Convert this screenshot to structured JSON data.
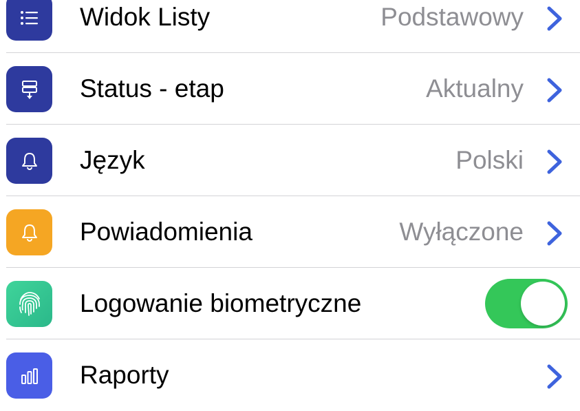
{
  "settings": {
    "colors": {
      "accent": "#3e63dd",
      "icon_navy": "#2e3a9e",
      "icon_orange": "#f5a623",
      "icon_green": "#34c793",
      "icon_blue": "#4a5ee6",
      "toggle_on": "#34c759",
      "secondary_text": "#8e8e93"
    },
    "rows": [
      {
        "label": "Widok Listy",
        "value": "Podstawowy",
        "icon": "list-icon"
      },
      {
        "label": "Status - etap",
        "value": "Aktualny",
        "icon": "status-stage-icon"
      },
      {
        "label": "Język",
        "value": "Polski",
        "icon": "bell-icon"
      },
      {
        "label": "Powiadomienia",
        "value": "Wyłączone",
        "icon": "bell-icon"
      },
      {
        "label": "Logowanie biometryczne",
        "toggle_on": true,
        "icon": "fingerprint-icon"
      },
      {
        "label": "Raporty",
        "icon": "bar-chart-icon"
      }
    ]
  }
}
